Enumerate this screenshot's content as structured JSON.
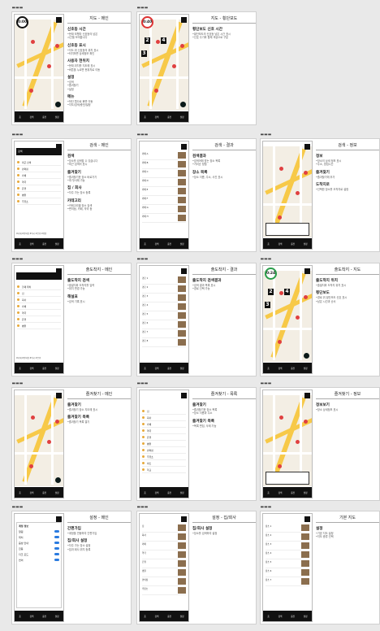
{
  "dots": "▬▬▬",
  "tabbar_labels": [
    "홈",
    "검색",
    "충전",
    "설정"
  ],
  "frames": [
    {
      "id": "main",
      "title": "지도 - 메인",
      "timer": "0:00",
      "sections": [
        {
          "t": "신호등 시간",
          "b": "•현재 보행자 신호등의 남은\n 시간을 보여줍니다"
        },
        {
          "t": "신호등 표시",
          "b": "•지도 위 신호등의 위치 표시\n•터치하면 상세정보 확인"
        },
        {
          "t": "사용자 현위치",
          "b": "•현재 위치를 지도에 표시\n•버튼을 누르면 현위치로 이동"
        },
        {
          "t": "설정",
          "b": "•검색\n•즐겨찾기\n•설정"
        },
        {
          "t": "메뉴",
          "b": "•하단 탭으로 화면 이동\n•지도/검색/충전/설정"
        }
      ]
    },
    {
      "id": "crossing",
      "title": "지도 - 횡단보도",
      "timer": "0:40",
      "markers": [
        "2",
        "4",
        "3"
      ],
      "sections": [
        {
          "t": "횡단보도 신호 시간",
          "b": "•횡단보도의 신호등 남은 시간 표시\n•신호 주기와 함께 색상으로 구분"
        }
      ]
    },
    {
      "id": "search-main",
      "title": "검색 - 메인",
      "search_placeholder": "검색",
      "list": [
        "최근 검색",
        "편의점",
        "카페",
        "약국",
        "은행",
        "병원",
        "주유소"
      ],
      "chips": "#카페 #편의점 #약국 #은행 #병원",
      "sections": [
        {
          "t": "검색",
          "b": "•장소를 검색할 수 있습니다\n•최근 검색어 표시"
        },
        {
          "t": "즐겨찾기",
          "b": "•즐겨찾기한 장소 바로가기\n•추가/삭제 가능"
        },
        {
          "t": "집 / 회사",
          "b": "•자주 가는 장소 등록"
        },
        {
          "t": "카테고리",
          "b": "•카테고리별 장소 검색\n•편의점, 카페, 약국 등"
        }
      ]
    },
    {
      "id": "search-result",
      "title": "검색 - 결과",
      "results": [
        "카페 A",
        "카페 B",
        "카페 C",
        "카페 D",
        "카페 E",
        "카페 F",
        "카페 G",
        "카페 H"
      ],
      "sections": [
        {
          "t": "검색결과",
          "b": "•검색어에 맞는 장소 목록\n•거리순 정렬"
        },
        {
          "t": "장소 목록",
          "b": "•장소 이름, 주소, 사진 표시"
        }
      ]
    },
    {
      "id": "search-info",
      "title": "검색 - 정보",
      "sections": [
        {
          "t": "정보",
          "b": "•장소의 상세 정보 표시\n•주소, 영업시간"
        },
        {
          "t": "즐겨찾기",
          "b": "•즐겨찾기에 추가"
        },
        {
          "t": "도착지로",
          "b": "•선택한 장소를 도착지로 설정"
        }
      ]
    },
    {
      "id": "dest-main",
      "title": "출도착지 - 메인",
      "list": [
        "현재 위치",
        "집",
        "회사",
        "카페",
        "약국",
        "은행",
        "병원"
      ],
      "chips": "#카페 #편의점 #약국 #은행",
      "sections": [
        {
          "t": "출도착지 검색",
          "b": "•출발지와 도착지를 입력\n•위치 변경 가능"
        },
        {
          "t": "해설표",
          "b": "•검색 기록 표시"
        }
      ]
    },
    {
      "id": "dest-result",
      "title": "출도착지 - 결과",
      "results": [
        "경로 1",
        "경로 2",
        "경로 3",
        "경로 4",
        "경로 5",
        "경로 6",
        "경로 7",
        "경로 8"
      ],
      "sections": [
        {
          "t": "출도착지 검색결과",
          "b": "•검색 결과 목록 표시\n•경로 선택 가능"
        }
      ]
    },
    {
      "id": "dest-map",
      "title": "출도착지 - 지도",
      "timer": "0:24",
      "markers": [
        "2",
        "4",
        "3"
      ],
      "sections": [
        {
          "t": "출도착지 위치",
          "b": "•출발지와 도착지 위치 표시"
        },
        {
          "t": "횡단보도",
          "b": "•경로 위 횡단보도 신호 표시\n•남은 시간과 순서"
        }
      ]
    },
    {
      "id": "fav-main",
      "title": "즐겨찾기 - 메인",
      "sections": [
        {
          "t": "즐겨찾기",
          "b": "•즐겨찾기 장소 지도에 표시"
        },
        {
          "t": "즐겨찾기 목록",
          "b": "•즐겨찾기 목록 열기"
        }
      ]
    },
    {
      "id": "fav-list",
      "title": "즐겨찾기 - 목록",
      "list": [
        "집",
        "회사",
        "카페",
        "약국",
        "은행",
        "병원",
        "편의점",
        "주유소",
        "마트",
        "학교"
      ],
      "sections": [
        {
          "t": "즐겨찾기",
          "b": "•즐겨찾기한 장소 목록\n•장소 이름과 주소"
        },
        {
          "t": "즐겨찾기 목록",
          "b": "•목록 편집, 삭제 가능"
        }
      ]
    },
    {
      "id": "fav-info",
      "title": "즐겨찾기 - 정보",
      "sections": [
        {
          "t": "정보보기",
          "b": "•장소 상세정보 표시"
        }
      ]
    },
    {
      "id": "settings-main",
      "title": "설정 - 메인",
      "sheet_title": "계정 정보",
      "sheet_items": [
        "알림",
        "위치",
        "음성 안내",
        "진동",
        "다크 모드",
        "언어"
      ],
      "sections": [
        {
          "t": "간편가입",
          "b": "•계정을 연동하여 간편가입"
        },
        {
          "t": "집/회사 설정",
          "b": "•자주 가는 장소 설정\n•집과 회사 위치 등록"
        }
      ]
    },
    {
      "id": "settings-home",
      "title": "설정 - 집/회사",
      "results": [
        "집",
        "회사",
        "카페",
        "약국",
        "은행",
        "병원",
        "편의점",
        "주유소"
      ],
      "sections": [
        {
          "t": "집/회사 설정",
          "b": "•장소를 검색하여 설정"
        }
      ]
    },
    {
      "id": "base-map",
      "title": "기본 지도",
      "results": [
        "장소 1",
        "장소 2",
        "장소 3",
        "장소 4",
        "장소 5",
        "장소 6",
        "장소 7"
      ],
      "sections": [
        {
          "t": "설정",
          "b": "•기본 지도 설정\n•지도 종류 선택"
        }
      ]
    }
  ]
}
